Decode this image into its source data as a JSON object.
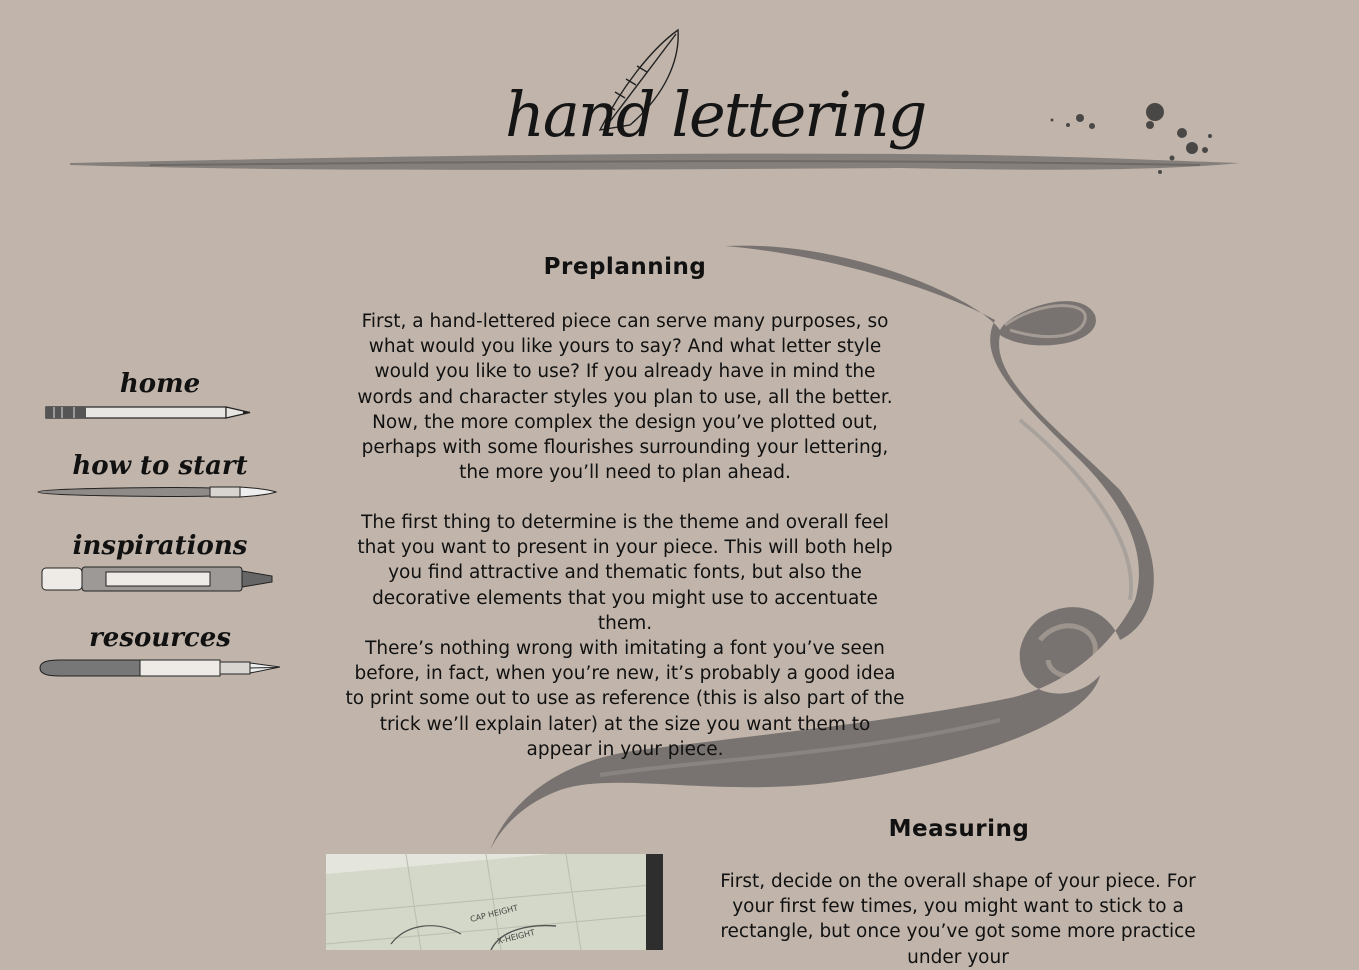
{
  "header": {
    "logo_text": "hand lettering"
  },
  "nav": [
    {
      "label": "home",
      "icon": "pencil-icon"
    },
    {
      "label": "how to start",
      "icon": "brush-icon"
    },
    {
      "label": "inspirations",
      "icon": "marker-icon"
    },
    {
      "label": "resources",
      "icon": "fountain-pen-icon"
    }
  ],
  "sections": {
    "preplanning": {
      "title": "Preplanning",
      "paragraphs": [
        "First, a hand-lettered piece can serve many purposes, so what would you like yours to say? And what letter style would you like to use? If you already have in mind the words and character styles you plan to use, all the better. Now, the more complex the design you’ve plotted out, perhaps with some flourishes surrounding your lettering, the more you’ll need to plan ahead.",
        "The first thing to determine is the theme and overall feel that you want to present in your piece. This will both help you find attractive and thematic fonts, but also the decorative elements that you might use to accentuate them.",
        "There’s nothing wrong with imitating a font you’ve seen before, in fact, when you’re new, it’s probably a good idea to print some out to use as reference (this is also part of the trick we’ll explain later) at the size you want them to appear in your piece."
      ]
    },
    "measuring": {
      "title": "Measuring",
      "paragraph": "First, decide on the overall shape of your piece. For your first few times, you might want to stick to a rectangle, but once you’ve got some more practice under your"
    }
  },
  "photo": {
    "labels": [
      "CAP HEIGHT",
      "X-HEIGHT"
    ]
  },
  "colors": {
    "background": "#c1b5ab",
    "ink": "#111111",
    "stroke": "#6e6b69"
  }
}
